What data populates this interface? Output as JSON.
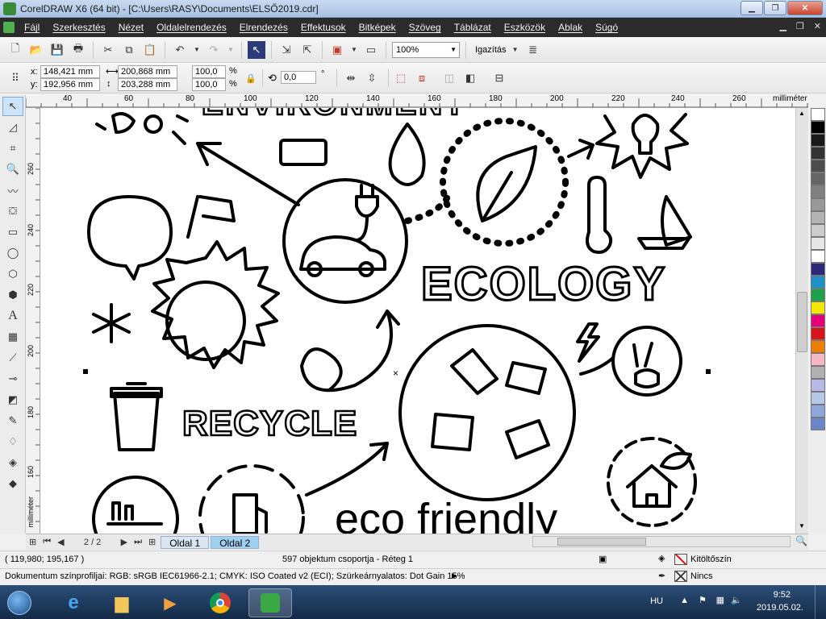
{
  "window": {
    "title": "CorelDRAW X6 (64 bit) - [C:\\Users\\RASY\\Documents\\ELSŐ2019.cdr]"
  },
  "menu": {
    "items": [
      "Fájl",
      "Szerkesztés",
      "Nézet",
      "Oldalelrendezés",
      "Elrendezés",
      "Effektusok",
      "Bitképek",
      "Szöveg",
      "Táblázat",
      "Eszközök",
      "Ablak",
      "Súgó"
    ]
  },
  "toolbar": {
    "zoom": "100%",
    "snap_label": "Igazítás"
  },
  "properties": {
    "x_label": "x:",
    "y_label": "y:",
    "x": "148,421 mm",
    "y": "192,956 mm",
    "width": "200,868 mm",
    "height": "203,288 mm",
    "scale_x": "100,0",
    "scale_y": "100,0",
    "percent": "%",
    "rotation": "0,0",
    "degree": "°"
  },
  "rulers": {
    "unit": "milliméter",
    "top_ticks": [
      "40",
      "60",
      "80",
      "100",
      "120",
      "140",
      "160",
      "180",
      "200",
      "220",
      "240",
      "260"
    ],
    "left_ticks": [
      "260",
      "240",
      "220",
      "200",
      "180",
      "160"
    ]
  },
  "artwork": {
    "ecology": "ECOLOGY",
    "recycle": "RECYCLE",
    "eco_friendly": "eco friendly",
    "environment_partial": "ENVIRONMENT"
  },
  "pages": {
    "indicator": "2 / 2",
    "tabs": [
      "Oldal 1",
      "Oldal 2"
    ],
    "active_index": 1
  },
  "status": {
    "cursor": "( 119,980; 195,167 )",
    "selection": "597 objektum csoportja - Réteg 1",
    "fill_label": "Kitöltőszín",
    "outline_label": "Nincs",
    "color_profile": "Dokumentum színprofiljai: RGB: sRGB IEC61966-2.1; CMYK: ISO Coated v2 (ECI); Szürkeárnyalatos: Dot Gain 15%"
  },
  "palette": {
    "colors": [
      "#ffffff",
      "#000000",
      "#1a1a1a",
      "#333333",
      "#4d4d4d",
      "#666666",
      "#808080",
      "#999999",
      "#b3b3b3",
      "#cccccc",
      "#e6e6e6",
      "#ffffff",
      "#2e2a7a",
      "#1e90c8",
      "#1da24a",
      "#f3e600",
      "#e4007c",
      "#d7141a",
      "#ef7d00",
      "#f6b8c2",
      "#b0b0b0",
      "#b8b8e8",
      "#b7c7e8",
      "#8fa7d8",
      "#6a86c8"
    ]
  },
  "taskbar": {
    "language": "HU",
    "time": "9:52",
    "date": "2019.05.02."
  }
}
